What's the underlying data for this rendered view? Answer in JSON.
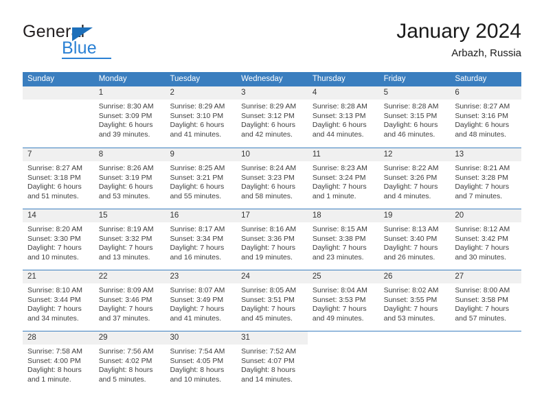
{
  "logo": {
    "word_one": "General",
    "word_two": "Blue",
    "accent_color": "#2980d4",
    "triangle_color": "#1c6fba"
  },
  "header": {
    "title": "January 2024",
    "subtitle": "Arbazh, Russia"
  },
  "calendar": {
    "header_bg": "#3a7ebf",
    "daynum_bg": "#f0f0f0",
    "day_names": [
      "Sunday",
      "Monday",
      "Tuesday",
      "Wednesday",
      "Thursday",
      "Friday",
      "Saturday"
    ],
    "weeks": [
      [
        {
          "day": "",
          "sunrise": "",
          "sunset": "",
          "daylight": "",
          "empty": true
        },
        {
          "day": "1",
          "sunrise": "Sunrise: 8:30 AM",
          "sunset": "Sunset: 3:09 PM",
          "daylight": "Daylight: 6 hours and 39 minutes."
        },
        {
          "day": "2",
          "sunrise": "Sunrise: 8:29 AM",
          "sunset": "Sunset: 3:10 PM",
          "daylight": "Daylight: 6 hours and 41 minutes."
        },
        {
          "day": "3",
          "sunrise": "Sunrise: 8:29 AM",
          "sunset": "Sunset: 3:12 PM",
          "daylight": "Daylight: 6 hours and 42 minutes."
        },
        {
          "day": "4",
          "sunrise": "Sunrise: 8:28 AM",
          "sunset": "Sunset: 3:13 PM",
          "daylight": "Daylight: 6 hours and 44 minutes."
        },
        {
          "day": "5",
          "sunrise": "Sunrise: 8:28 AM",
          "sunset": "Sunset: 3:15 PM",
          "daylight": "Daylight: 6 hours and 46 minutes."
        },
        {
          "day": "6",
          "sunrise": "Sunrise: 8:27 AM",
          "sunset": "Sunset: 3:16 PM",
          "daylight": "Daylight: 6 hours and 48 minutes."
        }
      ],
      [
        {
          "day": "7",
          "sunrise": "Sunrise: 8:27 AM",
          "sunset": "Sunset: 3:18 PM",
          "daylight": "Daylight: 6 hours and 51 minutes."
        },
        {
          "day": "8",
          "sunrise": "Sunrise: 8:26 AM",
          "sunset": "Sunset: 3:19 PM",
          "daylight": "Daylight: 6 hours and 53 minutes."
        },
        {
          "day": "9",
          "sunrise": "Sunrise: 8:25 AM",
          "sunset": "Sunset: 3:21 PM",
          "daylight": "Daylight: 6 hours and 55 minutes."
        },
        {
          "day": "10",
          "sunrise": "Sunrise: 8:24 AM",
          "sunset": "Sunset: 3:23 PM",
          "daylight": "Daylight: 6 hours and 58 minutes."
        },
        {
          "day": "11",
          "sunrise": "Sunrise: 8:23 AM",
          "sunset": "Sunset: 3:24 PM",
          "daylight": "Daylight: 7 hours and 1 minute."
        },
        {
          "day": "12",
          "sunrise": "Sunrise: 8:22 AM",
          "sunset": "Sunset: 3:26 PM",
          "daylight": "Daylight: 7 hours and 4 minutes."
        },
        {
          "day": "13",
          "sunrise": "Sunrise: 8:21 AM",
          "sunset": "Sunset: 3:28 PM",
          "daylight": "Daylight: 7 hours and 7 minutes."
        }
      ],
      [
        {
          "day": "14",
          "sunrise": "Sunrise: 8:20 AM",
          "sunset": "Sunset: 3:30 PM",
          "daylight": "Daylight: 7 hours and 10 minutes."
        },
        {
          "day": "15",
          "sunrise": "Sunrise: 8:19 AM",
          "sunset": "Sunset: 3:32 PM",
          "daylight": "Daylight: 7 hours and 13 minutes."
        },
        {
          "day": "16",
          "sunrise": "Sunrise: 8:17 AM",
          "sunset": "Sunset: 3:34 PM",
          "daylight": "Daylight: 7 hours and 16 minutes."
        },
        {
          "day": "17",
          "sunrise": "Sunrise: 8:16 AM",
          "sunset": "Sunset: 3:36 PM",
          "daylight": "Daylight: 7 hours and 19 minutes."
        },
        {
          "day": "18",
          "sunrise": "Sunrise: 8:15 AM",
          "sunset": "Sunset: 3:38 PM",
          "daylight": "Daylight: 7 hours and 23 minutes."
        },
        {
          "day": "19",
          "sunrise": "Sunrise: 8:13 AM",
          "sunset": "Sunset: 3:40 PM",
          "daylight": "Daylight: 7 hours and 26 minutes."
        },
        {
          "day": "20",
          "sunrise": "Sunrise: 8:12 AM",
          "sunset": "Sunset: 3:42 PM",
          "daylight": "Daylight: 7 hours and 30 minutes."
        }
      ],
      [
        {
          "day": "21",
          "sunrise": "Sunrise: 8:10 AM",
          "sunset": "Sunset: 3:44 PM",
          "daylight": "Daylight: 7 hours and 34 minutes."
        },
        {
          "day": "22",
          "sunrise": "Sunrise: 8:09 AM",
          "sunset": "Sunset: 3:46 PM",
          "daylight": "Daylight: 7 hours and 37 minutes."
        },
        {
          "day": "23",
          "sunrise": "Sunrise: 8:07 AM",
          "sunset": "Sunset: 3:49 PM",
          "daylight": "Daylight: 7 hours and 41 minutes."
        },
        {
          "day": "24",
          "sunrise": "Sunrise: 8:05 AM",
          "sunset": "Sunset: 3:51 PM",
          "daylight": "Daylight: 7 hours and 45 minutes."
        },
        {
          "day": "25",
          "sunrise": "Sunrise: 8:04 AM",
          "sunset": "Sunset: 3:53 PM",
          "daylight": "Daylight: 7 hours and 49 minutes."
        },
        {
          "day": "26",
          "sunrise": "Sunrise: 8:02 AM",
          "sunset": "Sunset: 3:55 PM",
          "daylight": "Daylight: 7 hours and 53 minutes."
        },
        {
          "day": "27",
          "sunrise": "Sunrise: 8:00 AM",
          "sunset": "Sunset: 3:58 PM",
          "daylight": "Daylight: 7 hours and 57 minutes."
        }
      ],
      [
        {
          "day": "28",
          "sunrise": "Sunrise: 7:58 AM",
          "sunset": "Sunset: 4:00 PM",
          "daylight": "Daylight: 8 hours and 1 minute."
        },
        {
          "day": "29",
          "sunrise": "Sunrise: 7:56 AM",
          "sunset": "Sunset: 4:02 PM",
          "daylight": "Daylight: 8 hours and 5 minutes."
        },
        {
          "day": "30",
          "sunrise": "Sunrise: 7:54 AM",
          "sunset": "Sunset: 4:05 PM",
          "daylight": "Daylight: 8 hours and 10 minutes."
        },
        {
          "day": "31",
          "sunrise": "Sunrise: 7:52 AM",
          "sunset": "Sunset: 4:07 PM",
          "daylight": "Daylight: 8 hours and 14 minutes."
        },
        {
          "day": "",
          "sunrise": "",
          "sunset": "",
          "daylight": "",
          "empty": true,
          "blank": true
        },
        {
          "day": "",
          "sunrise": "",
          "sunset": "",
          "daylight": "",
          "empty": true,
          "blank": true
        },
        {
          "day": "",
          "sunrise": "",
          "sunset": "",
          "daylight": "",
          "empty": true,
          "blank": true
        }
      ]
    ]
  }
}
